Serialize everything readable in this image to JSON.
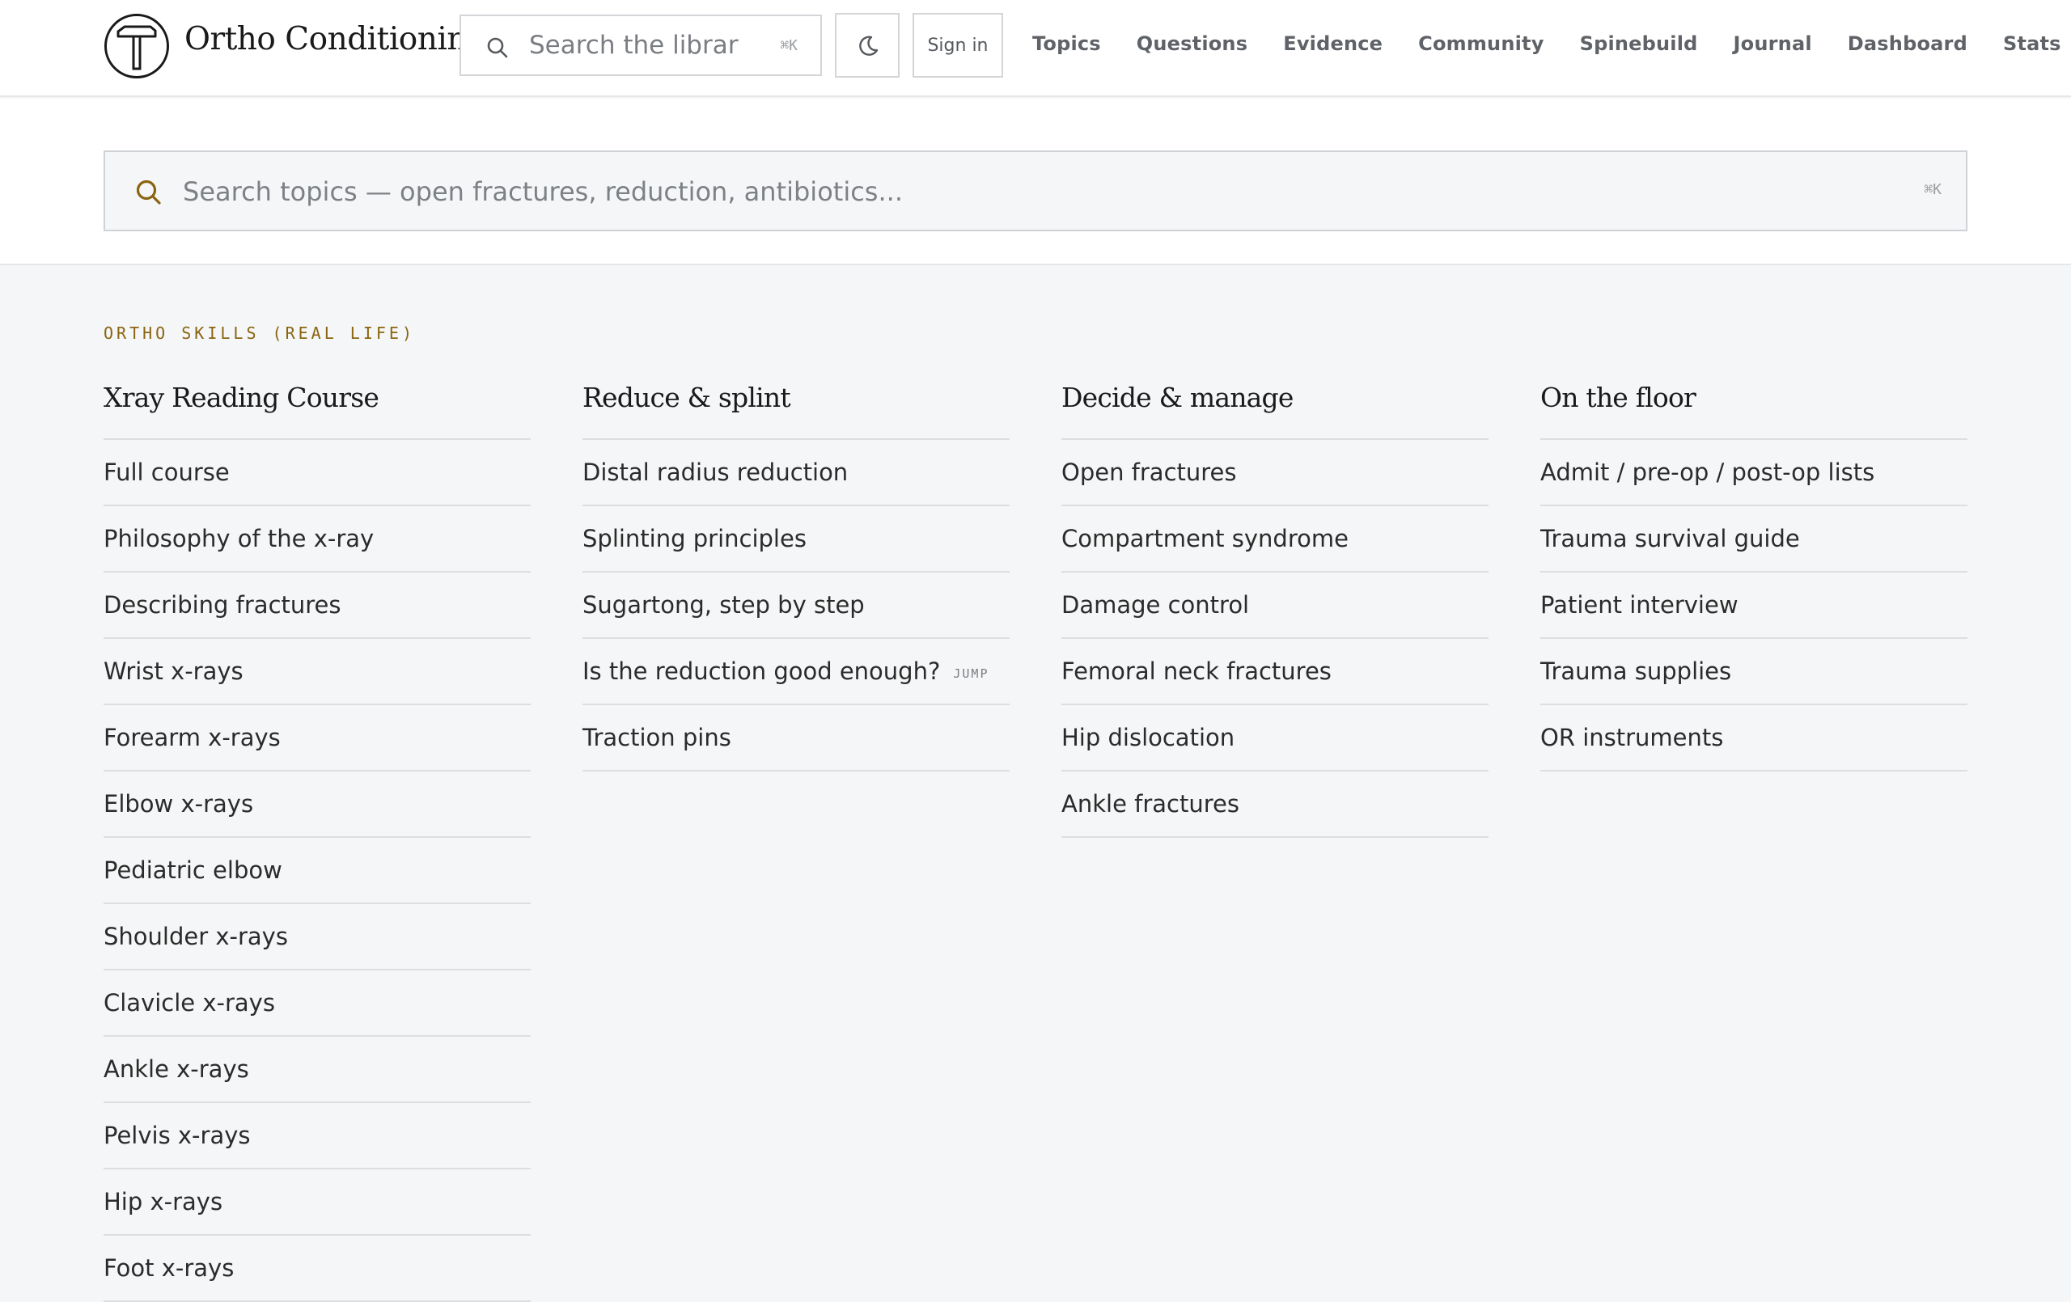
{
  "header": {
    "brand": "Ortho Conditioning",
    "logo_icon": "hammer-logo-icon",
    "search": {
      "placeholder": "Search the library",
      "shortcut": "⌘K"
    },
    "theme_toggle_icon": "moon-icon",
    "signin_label": "Sign in",
    "nav": [
      "Topics",
      "Questions",
      "Evidence",
      "Community",
      "Spinebuild",
      "Journal",
      "Dashboard",
      "Stats"
    ]
  },
  "topic_search": {
    "placeholder": "Search topics — open fractures, reduction, antibiotics...",
    "shortcut": "⌘K"
  },
  "section": {
    "eyebrow": "ORTHO SKILLS (REAL LIFE)",
    "columns": [
      {
        "title": "Xray Reading Course",
        "items": [
          {
            "label": "Full course"
          },
          {
            "label": "Philosophy of the x-ray"
          },
          {
            "label": "Describing fractures"
          },
          {
            "label": "Wrist x-rays"
          },
          {
            "label": "Forearm x-rays"
          },
          {
            "label": "Elbow x-rays"
          },
          {
            "label": "Pediatric elbow"
          },
          {
            "label": "Shoulder x-rays"
          },
          {
            "label": "Clavicle x-rays"
          },
          {
            "label": "Ankle x-rays"
          },
          {
            "label": "Pelvis x-rays"
          },
          {
            "label": "Hip x-rays"
          },
          {
            "label": "Foot x-rays"
          }
        ]
      },
      {
        "title": "Reduce & splint",
        "items": [
          {
            "label": "Distal radius reduction"
          },
          {
            "label": "Splinting principles"
          },
          {
            "label": "Sugartong, step by step"
          },
          {
            "label": "Is the reduction good enough?",
            "tag": "JUMP"
          },
          {
            "label": "Traction pins"
          }
        ]
      },
      {
        "title": "Decide & manage",
        "items": [
          {
            "label": "Open fractures"
          },
          {
            "label": "Compartment syndrome"
          },
          {
            "label": "Damage control"
          },
          {
            "label": "Femoral neck fractures"
          },
          {
            "label": "Hip dislocation"
          },
          {
            "label": "Ankle fractures"
          }
        ]
      },
      {
        "title": "On the floor",
        "items": [
          {
            "label": "Admit / pre-op / post-op lists"
          },
          {
            "label": "Trauma survival guide"
          },
          {
            "label": "Patient interview"
          },
          {
            "label": "Trauma supplies"
          },
          {
            "label": "OR instruments"
          }
        ]
      }
    ]
  }
}
